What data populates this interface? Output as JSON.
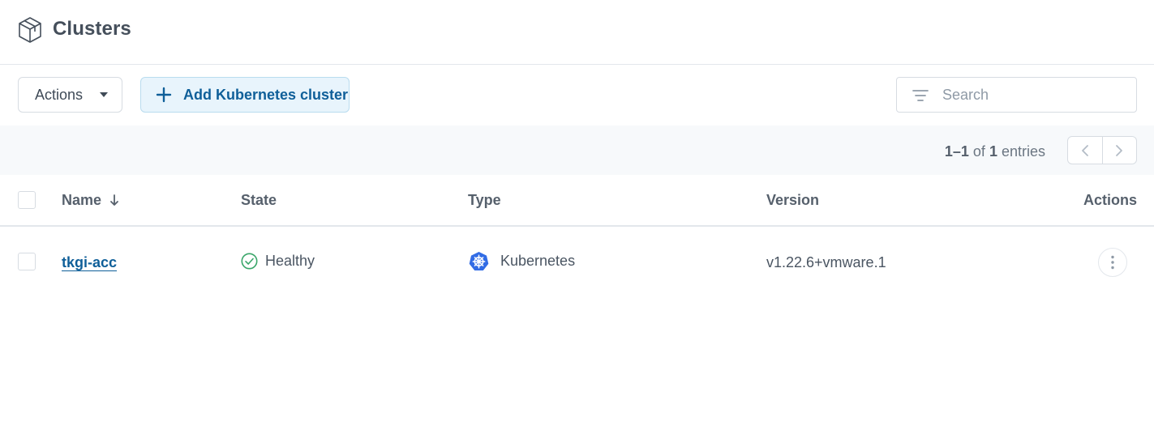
{
  "header": {
    "title": "Clusters",
    "icon": "cube-icon"
  },
  "toolbar": {
    "actions_label": "Actions",
    "add_label": "Add Kubernetes cluster",
    "search_placeholder": "Search"
  },
  "pagination": {
    "range": "1–1",
    "of_text": "of",
    "total": "1",
    "suffix": "entries"
  },
  "table": {
    "columns": [
      "Name",
      "State",
      "Type",
      "Version",
      "Actions"
    ],
    "sort": {
      "column": "Name",
      "direction": "descending"
    },
    "rows": [
      {
        "name": "tkgi-acc",
        "state": "Healthy",
        "type": "Kubernetes",
        "version": "v1.22.6+vmware.1"
      }
    ]
  },
  "colors": {
    "accent": "#0f5f99",
    "accent_bg": "#e8f4fc",
    "healthy": "#3aa66a",
    "kubernetes": "#326ce5"
  }
}
